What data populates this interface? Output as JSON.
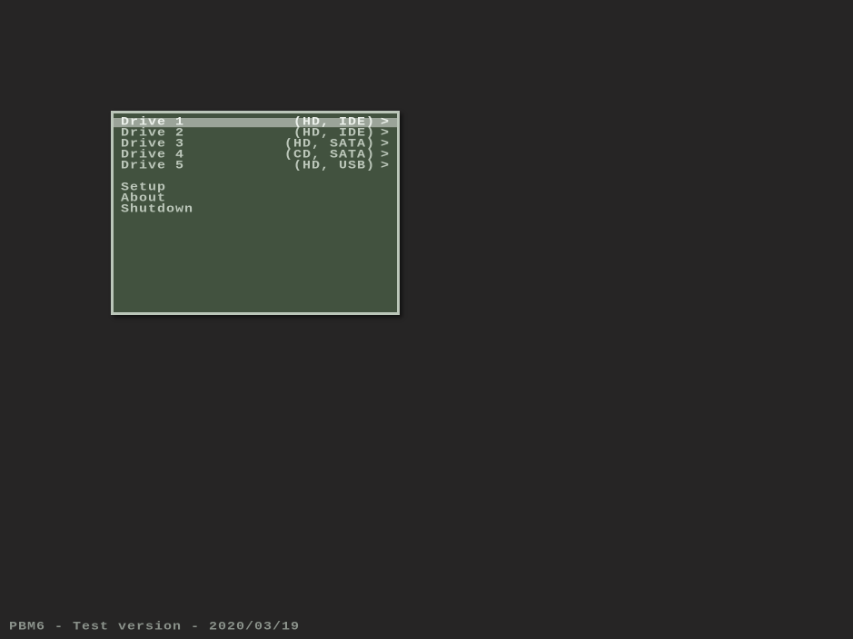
{
  "menu": {
    "selectedIndex": 0,
    "drives": [
      {
        "label": "Drive 1",
        "detail": "(HD, IDE)",
        "arrow": ">"
      },
      {
        "label": "Drive 2",
        "detail": "(HD, IDE)",
        "arrow": ">"
      },
      {
        "label": "Drive 3",
        "detail": "(HD, SATA)",
        "arrow": ">"
      },
      {
        "label": "Drive 4",
        "detail": "(CD, SATA)",
        "arrow": ">"
      },
      {
        "label": "Drive 5",
        "detail": "(HD, USB)",
        "arrow": ">"
      }
    ],
    "actions": [
      {
        "label": "Setup"
      },
      {
        "label": "About"
      },
      {
        "label": "Shutdown"
      }
    ]
  },
  "status": {
    "text": "PBM6 - Test version - 2020/03/19"
  }
}
